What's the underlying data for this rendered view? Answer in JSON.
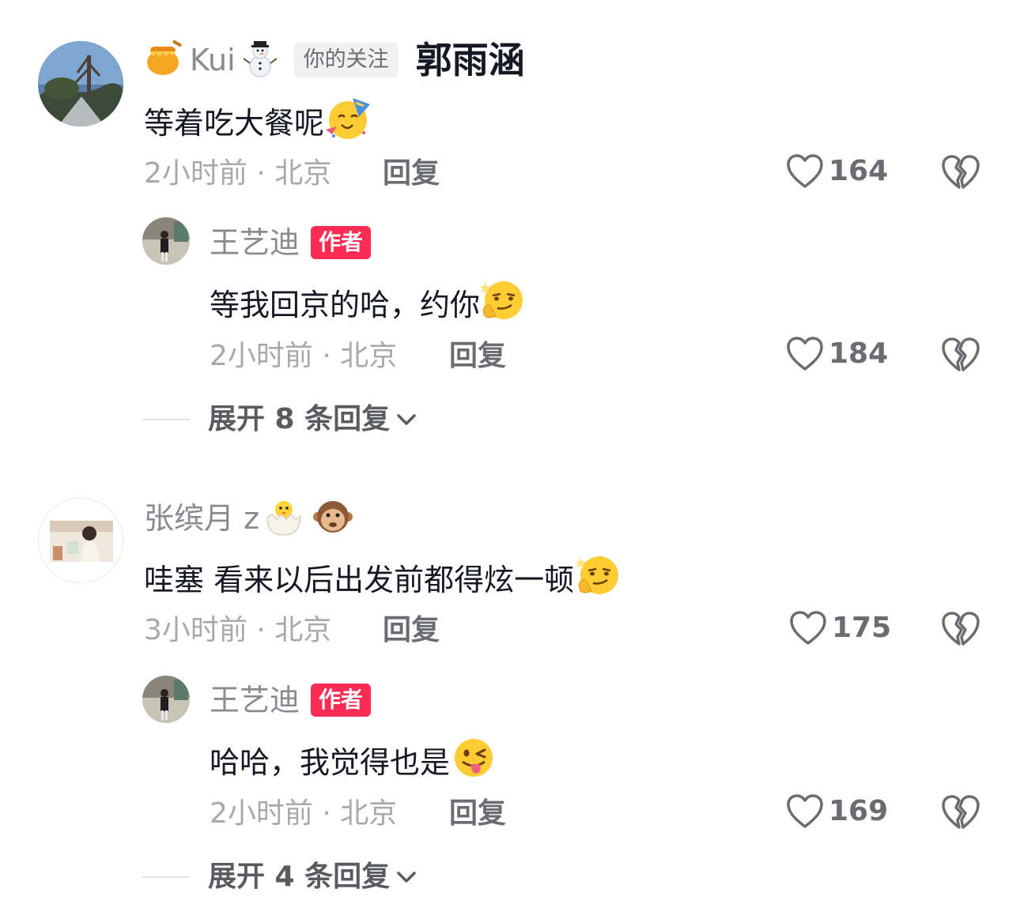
{
  "threads": [
    {
      "user": {
        "name": "Kui",
        "badge": "你的关注",
        "mention": "郭雨涵",
        "prefix_emoji": "honey-pot-icon",
        "suffix_emoji": "snowman-icon"
      },
      "text": "等着吃大餐呢",
      "emoji": "partying-face-icon",
      "time": "2小时前 · 北京",
      "reply": "回复",
      "likes": "164",
      "reply_comment": {
        "user": {
          "name": "王艺迪",
          "badge": "作者"
        },
        "text": "等我回京的哈，约你",
        "emoji": "smirk-thinking-icon",
        "time": "2小时前 · 北京",
        "reply": "回复",
        "likes": "184"
      },
      "expand": "展开 8 条回复"
    },
    {
      "user": {
        "name": "张缤月 z",
        "emoji1": "hatching-chick-icon",
        "emoji2": "monkey-face-icon"
      },
      "text": "哇塞 看来以后出发前都得炫一顿",
      "emoji": "smirk-thinking-icon",
      "time": "3小时前 · 北京",
      "reply": "回复",
      "likes": "175",
      "reply_comment": {
        "user": {
          "name": "王艺迪",
          "badge": "作者"
        },
        "text": "哈哈，我觉得也是",
        "emoji": "winking-tongue-icon",
        "time": "2小时前 · 北京",
        "reply": "回复",
        "likes": "169"
      },
      "expand": "展开 4 条回复"
    }
  ],
  "colors": {
    "author_badge": "#fe2c55",
    "muted_text": "#a8a8ad",
    "primary_text": "#161823"
  }
}
